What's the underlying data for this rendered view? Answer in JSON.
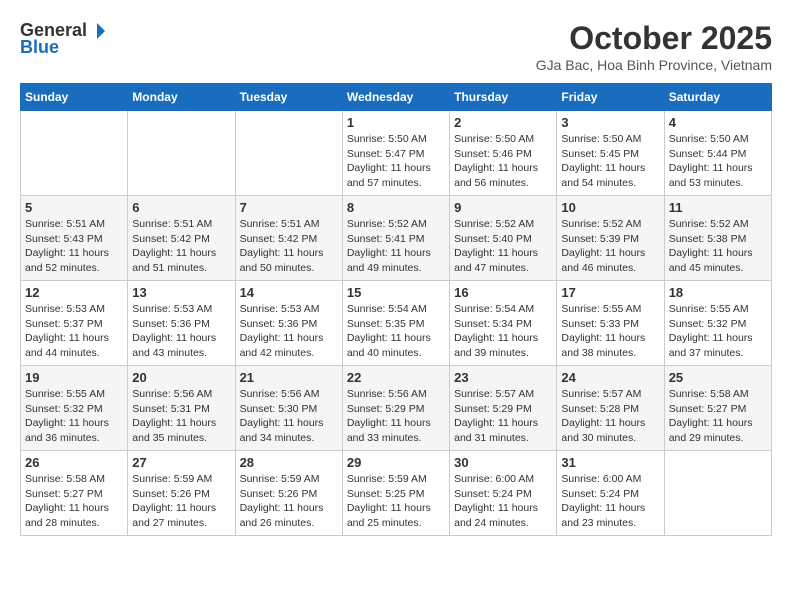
{
  "logo": {
    "general": "General",
    "blue": "Blue"
  },
  "title": "October 2025",
  "location": "GJa Bac, Hoa Binh Province, Vietnam",
  "days_of_week": [
    "Sunday",
    "Monday",
    "Tuesday",
    "Wednesday",
    "Thursday",
    "Friday",
    "Saturday"
  ],
  "weeks": [
    [
      {
        "day": null,
        "info": null
      },
      {
        "day": null,
        "info": null
      },
      {
        "day": null,
        "info": null
      },
      {
        "day": "1",
        "info": "Sunrise: 5:50 AM\nSunset: 5:47 PM\nDaylight: 11 hours\nand 57 minutes."
      },
      {
        "day": "2",
        "info": "Sunrise: 5:50 AM\nSunset: 5:46 PM\nDaylight: 11 hours\nand 56 minutes."
      },
      {
        "day": "3",
        "info": "Sunrise: 5:50 AM\nSunset: 5:45 PM\nDaylight: 11 hours\nand 54 minutes."
      },
      {
        "day": "4",
        "info": "Sunrise: 5:50 AM\nSunset: 5:44 PM\nDaylight: 11 hours\nand 53 minutes."
      }
    ],
    [
      {
        "day": "5",
        "info": "Sunrise: 5:51 AM\nSunset: 5:43 PM\nDaylight: 11 hours\nand 52 minutes."
      },
      {
        "day": "6",
        "info": "Sunrise: 5:51 AM\nSunset: 5:42 PM\nDaylight: 11 hours\nand 51 minutes."
      },
      {
        "day": "7",
        "info": "Sunrise: 5:51 AM\nSunset: 5:42 PM\nDaylight: 11 hours\nand 50 minutes."
      },
      {
        "day": "8",
        "info": "Sunrise: 5:52 AM\nSunset: 5:41 PM\nDaylight: 11 hours\nand 49 minutes."
      },
      {
        "day": "9",
        "info": "Sunrise: 5:52 AM\nSunset: 5:40 PM\nDaylight: 11 hours\nand 47 minutes."
      },
      {
        "day": "10",
        "info": "Sunrise: 5:52 AM\nSunset: 5:39 PM\nDaylight: 11 hours\nand 46 minutes."
      },
      {
        "day": "11",
        "info": "Sunrise: 5:52 AM\nSunset: 5:38 PM\nDaylight: 11 hours\nand 45 minutes."
      }
    ],
    [
      {
        "day": "12",
        "info": "Sunrise: 5:53 AM\nSunset: 5:37 PM\nDaylight: 11 hours\nand 44 minutes."
      },
      {
        "day": "13",
        "info": "Sunrise: 5:53 AM\nSunset: 5:36 PM\nDaylight: 11 hours\nand 43 minutes."
      },
      {
        "day": "14",
        "info": "Sunrise: 5:53 AM\nSunset: 5:36 PM\nDaylight: 11 hours\nand 42 minutes."
      },
      {
        "day": "15",
        "info": "Sunrise: 5:54 AM\nSunset: 5:35 PM\nDaylight: 11 hours\nand 40 minutes."
      },
      {
        "day": "16",
        "info": "Sunrise: 5:54 AM\nSunset: 5:34 PM\nDaylight: 11 hours\nand 39 minutes."
      },
      {
        "day": "17",
        "info": "Sunrise: 5:55 AM\nSunset: 5:33 PM\nDaylight: 11 hours\nand 38 minutes."
      },
      {
        "day": "18",
        "info": "Sunrise: 5:55 AM\nSunset: 5:32 PM\nDaylight: 11 hours\nand 37 minutes."
      }
    ],
    [
      {
        "day": "19",
        "info": "Sunrise: 5:55 AM\nSunset: 5:32 PM\nDaylight: 11 hours\nand 36 minutes."
      },
      {
        "day": "20",
        "info": "Sunrise: 5:56 AM\nSunset: 5:31 PM\nDaylight: 11 hours\nand 35 minutes."
      },
      {
        "day": "21",
        "info": "Sunrise: 5:56 AM\nSunset: 5:30 PM\nDaylight: 11 hours\nand 34 minutes."
      },
      {
        "day": "22",
        "info": "Sunrise: 5:56 AM\nSunset: 5:29 PM\nDaylight: 11 hours\nand 33 minutes."
      },
      {
        "day": "23",
        "info": "Sunrise: 5:57 AM\nSunset: 5:29 PM\nDaylight: 11 hours\nand 31 minutes."
      },
      {
        "day": "24",
        "info": "Sunrise: 5:57 AM\nSunset: 5:28 PM\nDaylight: 11 hours\nand 30 minutes."
      },
      {
        "day": "25",
        "info": "Sunrise: 5:58 AM\nSunset: 5:27 PM\nDaylight: 11 hours\nand 29 minutes."
      }
    ],
    [
      {
        "day": "26",
        "info": "Sunrise: 5:58 AM\nSunset: 5:27 PM\nDaylight: 11 hours\nand 28 minutes."
      },
      {
        "day": "27",
        "info": "Sunrise: 5:59 AM\nSunset: 5:26 PM\nDaylight: 11 hours\nand 27 minutes."
      },
      {
        "day": "28",
        "info": "Sunrise: 5:59 AM\nSunset: 5:26 PM\nDaylight: 11 hours\nand 26 minutes."
      },
      {
        "day": "29",
        "info": "Sunrise: 5:59 AM\nSunset: 5:25 PM\nDaylight: 11 hours\nand 25 minutes."
      },
      {
        "day": "30",
        "info": "Sunrise: 6:00 AM\nSunset: 5:24 PM\nDaylight: 11 hours\nand 24 minutes."
      },
      {
        "day": "31",
        "info": "Sunrise: 6:00 AM\nSunset: 5:24 PM\nDaylight: 11 hours\nand 23 minutes."
      },
      {
        "day": null,
        "info": null
      }
    ]
  ]
}
